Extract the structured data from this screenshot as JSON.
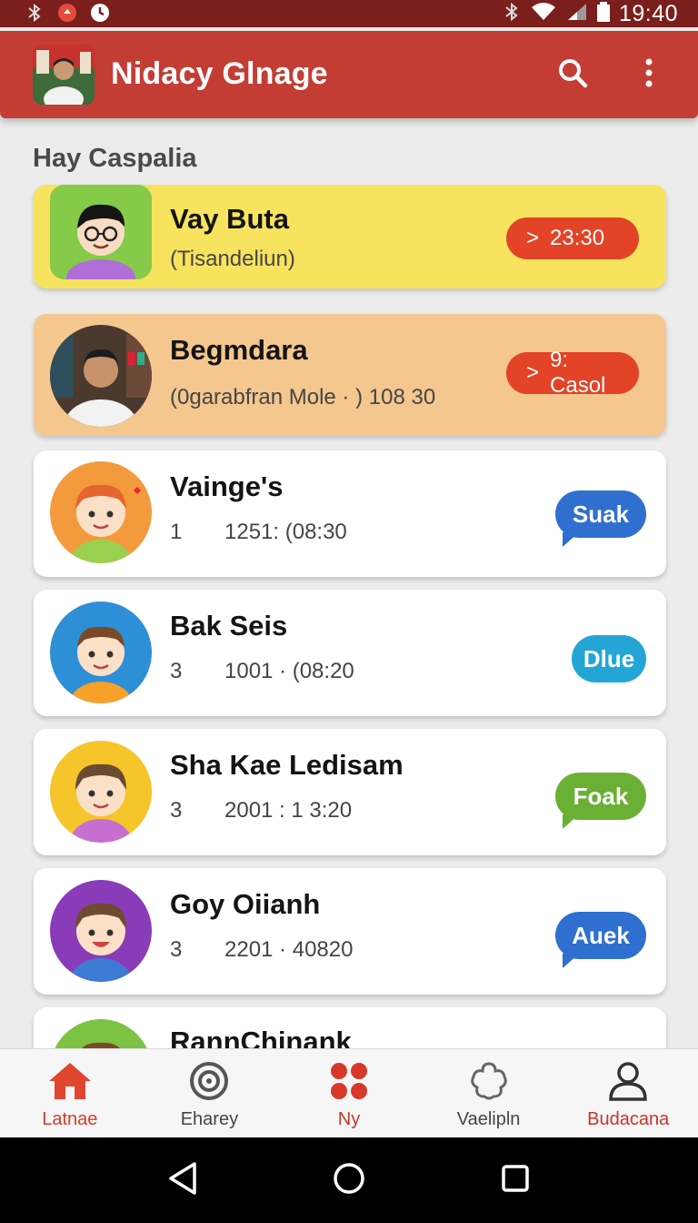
{
  "status_bar": {
    "time": "19:40"
  },
  "app_bar": {
    "title": "Nidacy Glnage"
  },
  "section_label": "Hay Caspalia",
  "items": [
    {
      "name": "Vay Buta",
      "sub": "(Tisandeliun)",
      "badge": "23:30",
      "badge_arrow": ">",
      "style": "yellow"
    },
    {
      "name": "Begmdara",
      "sub": "(0garabfran Mole · ) 108 30",
      "badge": "9: Casol",
      "badge_arrow": ">",
      "style": "peach"
    },
    {
      "name": "Vainge's",
      "count": "1",
      "meta": "1251: (08:30",
      "bubble": "Suak",
      "bubble_color": "#2f6fcf"
    },
    {
      "name": "Bak Seis",
      "count": "3",
      "meta": "1001 · (08:20",
      "bubble": "Dlue",
      "bubble_color": "#23a6d6"
    },
    {
      "name": "Sha Kae Ledisam",
      "count": "3",
      "meta": "2001 : 1 3:20",
      "bubble": "Foak",
      "bubble_color": "#6ab034"
    },
    {
      "name": "Goy Oiianh",
      "count": "3",
      "meta": "2201 · 40820",
      "bubble": "Auek",
      "bubble_color": "#2f6fcf"
    },
    {
      "name": "RannChinank"
    }
  ],
  "bottom_nav": [
    {
      "label": "Latnae",
      "icon": "home-icon"
    },
    {
      "label": "Eharey",
      "icon": "target-icon"
    },
    {
      "label": "Ny",
      "icon": "grid-dots-icon"
    },
    {
      "label": "Vaelipln",
      "icon": "flower-icon"
    },
    {
      "label": "Budacana",
      "icon": "person-icon"
    }
  ],
  "colors": {
    "primary": "#c33d34",
    "status_bar": "#7a1f1c",
    "badge": "#e34327"
  }
}
